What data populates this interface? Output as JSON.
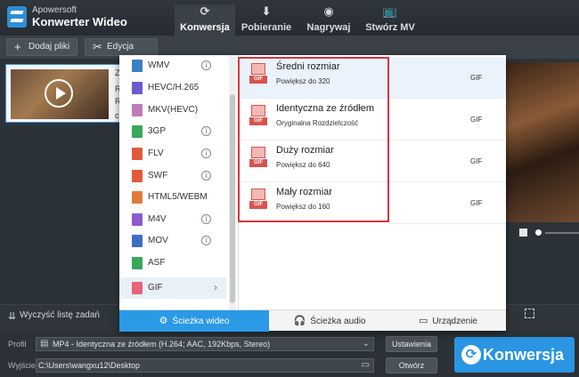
{
  "app": {
    "vendor": "Apowersoft",
    "name": "Konwerter Wideo"
  },
  "tabs": [
    {
      "label": "Konwersja",
      "icon": "refresh-icon",
      "active": true
    },
    {
      "label": "Pobieranie",
      "icon": "download-icon"
    },
    {
      "label": "Nagrywaj",
      "icon": "record-icon"
    },
    {
      "label": "Stwórz MV",
      "icon": "tv-icon"
    }
  ],
  "toolbar": {
    "add_files": "Dodaj pliki",
    "edit": "Edycja"
  },
  "file": {
    "name_fragment": "Zo",
    "r1": "R",
    "r2": "R",
    "r3": "c"
  },
  "formats": [
    {
      "label": "WMV",
      "color": "#3b7fc4",
      "info": true
    },
    {
      "label": "HEVC/H.265",
      "color": "#6a5acd",
      "info": false
    },
    {
      "label": "MKV(HEVC)",
      "color": "#c07ab8",
      "info": false
    },
    {
      "label": "3GP",
      "color": "#3aa65a",
      "info": true
    },
    {
      "label": "FLV",
      "color": "#e05a3a",
      "info": true
    },
    {
      "label": "SWF",
      "color": "#e05a3a",
      "info": true
    },
    {
      "label": "HTML5/WEBM",
      "color": "#e07b39",
      "info": false
    },
    {
      "label": "M4V",
      "color": "#8a5bd1",
      "info": true
    },
    {
      "label": "MOV",
      "color": "#3b6fc4",
      "info": true
    },
    {
      "label": "ASF",
      "color": "#3aa65a",
      "info": false
    },
    {
      "label": "GIF",
      "color": "#e3647c",
      "info": false,
      "selected": true
    }
  ],
  "resolutions": [
    {
      "title": "Średni rozmiar",
      "sub": "Powiększ do 320",
      "fmt": "GIF"
    },
    {
      "title": "Identyczna ze źródłem",
      "sub": "Oryginalna Rozdzielczość",
      "fmt": "GIF"
    },
    {
      "title": "Duży rozmiar",
      "sub": "Powiększ do 640",
      "fmt": "GIF"
    },
    {
      "title": "Mały rozmiar",
      "sub": "Powiększ do 160",
      "fmt": "GIF"
    }
  ],
  "icon_tag": "GIF",
  "popup_tabs": {
    "video": "Ścieżka wideo",
    "audio": "Ścieżka audio",
    "device": "Urządzenie"
  },
  "clear_label": "Wyczyść listę zadań",
  "profile": {
    "label": "Profil",
    "value": "MP4 - Identyczna ze źródłem (H.264; AAC, 192Kbps, Stereo)",
    "button": "Ustawienia"
  },
  "output": {
    "label": "Wyjście",
    "value": "C:\\Users\\wangxu12\\Desktop",
    "button": "Otwórz"
  },
  "convert_label": "Konwersja",
  "colors": {
    "accent": "#2a95e2",
    "highlight_border": "#d9333f"
  }
}
